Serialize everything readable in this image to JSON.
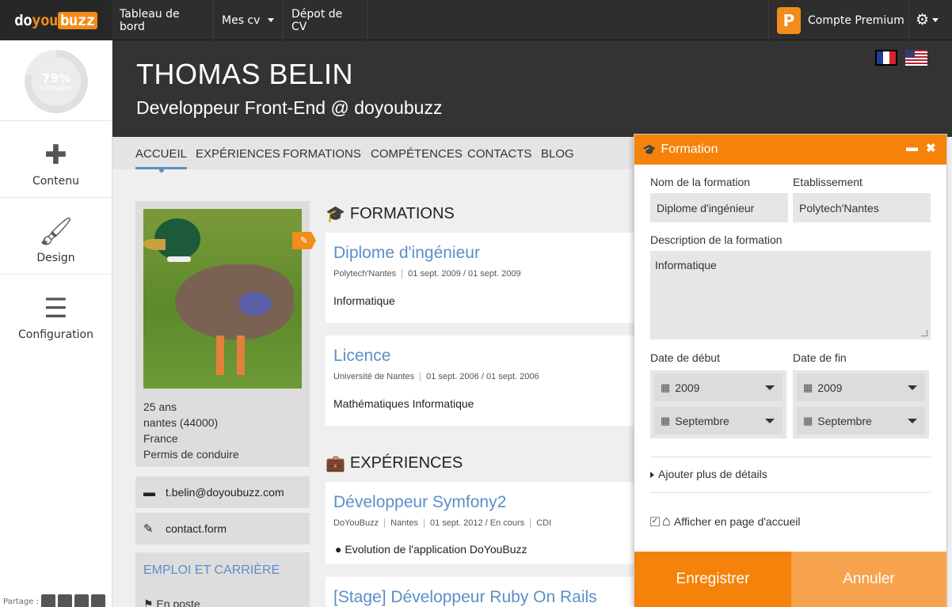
{
  "nav": {
    "logo_do": "do",
    "logo_you": "you",
    "logo_buzz": "buzz",
    "dashboard": "Tableau de bord",
    "my_cvs": "Mes cv",
    "cv_upload": "Dépot de CV",
    "premium": "Compte Premium",
    "premium_badge": "P"
  },
  "sidebar": {
    "progress_pct": "79%",
    "progress_label": "complet",
    "progress_value": 0.79,
    "items": [
      {
        "label": "Contenu",
        "icon": "plus-icon"
      },
      {
        "label": "Design",
        "icon": "brush-icon"
      },
      {
        "label": "Configuration",
        "icon": "sliders-icon"
      }
    ],
    "share_label": "Partage :"
  },
  "header": {
    "name": "THOMAS BELIN",
    "subtitle": "Developpeur Front-End @ doyoubuzz"
  },
  "tabs": [
    "ACCUEIL",
    "EXPÉRIENCES",
    "FORMATIONS",
    "COMPÉTENCES",
    "CONTACTS",
    "BLOG"
  ],
  "profile": {
    "age": "25 ans",
    "city": "nantes (44000)",
    "country": "France",
    "license": "Permis de conduire",
    "email": "t.belin@doyoubuzz.com",
    "contact_form": "contact.form",
    "employment_title": "EMPLOI ET CARRIÈRE",
    "employment_status": "En poste"
  },
  "formations": {
    "title": "FORMATIONS",
    "items": [
      {
        "title": "Diplome d'ingénieur",
        "school": "Polytech'Nantes",
        "dates": "01 sept. 2009 / 01 sept. 2009",
        "desc": "Informatique"
      },
      {
        "title": "Licence",
        "school": "Université de Nantes",
        "dates": "01 sept. 2006 / 01 sept. 2006",
        "desc": "Mathématiques Informatique"
      }
    ]
  },
  "experiences": {
    "title": "EXPÉRIENCES",
    "items": [
      {
        "title": "Développeur Symfony2",
        "company": "DoYouBuzz",
        "city": "Nantes",
        "dates": "01 sept. 2012 / En cours",
        "contract": "CDI",
        "bullet": "Evolution de l'application DoYouBuzz"
      },
      {
        "title": "[Stage] Développeur Ruby On Rails"
      }
    ]
  },
  "panel": {
    "title": "Formation",
    "name_label": "Nom de la formation",
    "name_value": "Diplome d'ingénieur",
    "school_label": "Etablissement",
    "school_value": "Polytech'Nantes",
    "desc_label": "Description de la formation",
    "desc_value": "Informatique",
    "start_label": "Date de début",
    "end_label": "Date de fin",
    "start_year": "2009",
    "start_month": "Septembre",
    "end_year": "2009",
    "end_month": "Septembre",
    "more_details": "Ajouter plus de détails",
    "show_home": "Afficher en page d'accueil",
    "save": "Enregistrer",
    "cancel": "Annuler"
  },
  "colors": {
    "accent": "#f5820a",
    "link": "#5b8fc7",
    "topbar": "#2e2e2e"
  }
}
